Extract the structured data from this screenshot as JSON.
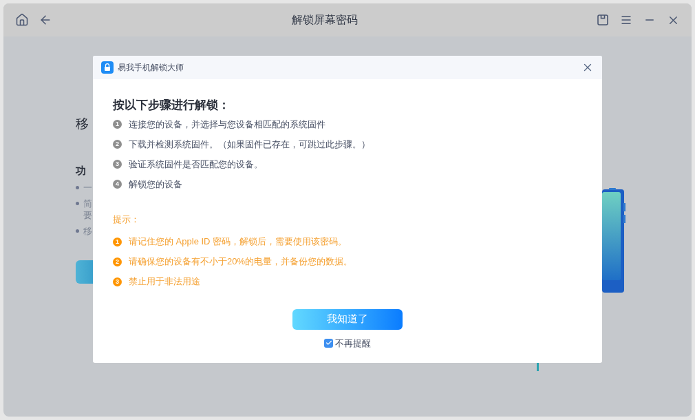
{
  "window": {
    "title": "解锁屏幕密码"
  },
  "background": {
    "heading": "移",
    "section_title": "功",
    "bullets": [
      {
        "lines": [
          "一"
        ]
      },
      {
        "lines": [
          "简",
          "要"
        ]
      },
      {
        "lines": [
          "移"
        ]
      }
    ]
  },
  "modal": {
    "title": "易我手机解锁大师",
    "heading": "按以下步骤进行解锁：",
    "steps": [
      {
        "number": "1",
        "text": "连接您的设备，并选择与您设备相匹配的系统固件"
      },
      {
        "number": "2",
        "text": "下载并检测系统固件。（如果固件已存在，可跳过此步骤。）"
      },
      {
        "number": "3",
        "text": "验证系统固件是否匹配您的设备。"
      },
      {
        "number": "4",
        "text": "解锁您的设备"
      }
    ],
    "tips_label": "提示：",
    "tips": [
      {
        "number": "1",
        "text": "请记住您的 Apple ID 密码，解锁后，需要使用该密码。"
      },
      {
        "number": "2",
        "text": "请确保您的设备有不小于20%的电量，并备份您的数据。"
      },
      {
        "number": "3",
        "text": "禁止用于非法用途"
      }
    ],
    "confirm_button": "我知道了",
    "dont_remind": {
      "label": "不再提醒",
      "checked": true
    }
  }
}
